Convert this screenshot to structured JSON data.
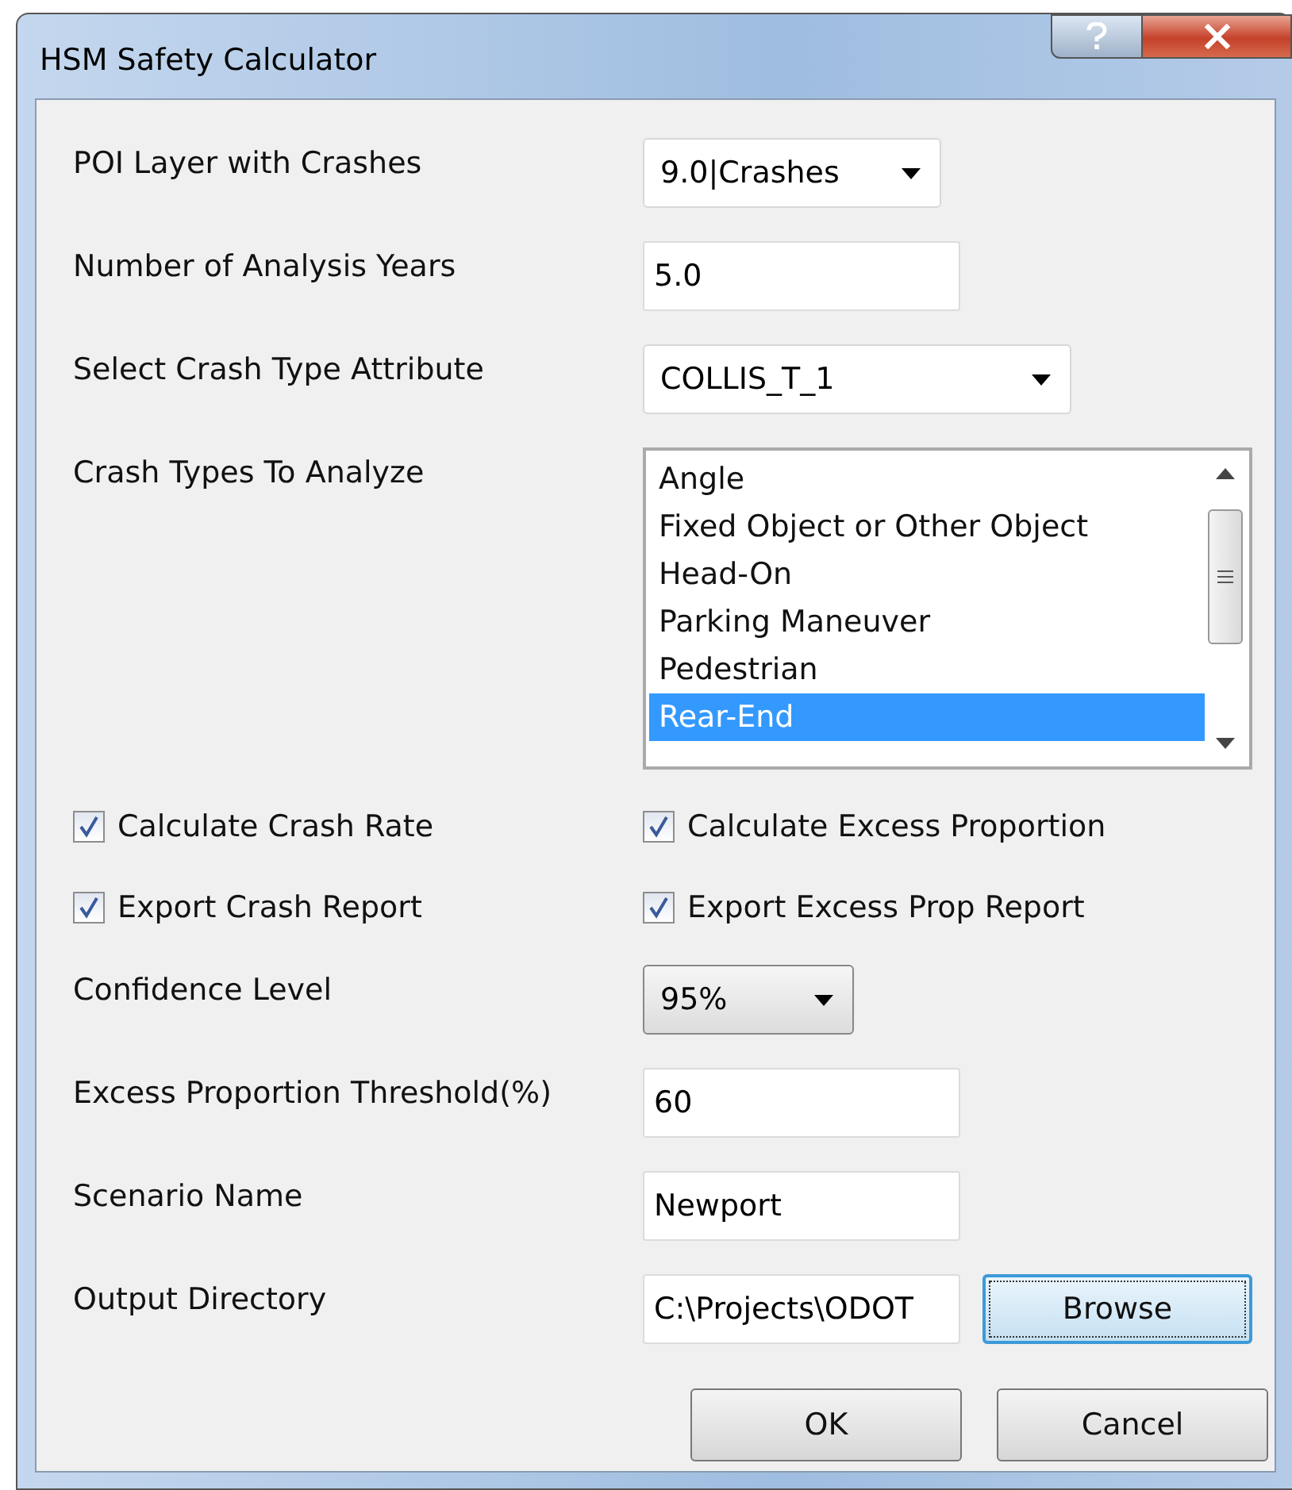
{
  "window": {
    "title": "HSM Safety Calculator"
  },
  "rows": [
    {
      "kind": "dropdown",
      "label": "POI Layer with Crashes",
      "value": "9.0|Crashes"
    },
    {
      "kind": "input",
      "label": "Number of Analysis Years",
      "value": "5.0"
    },
    {
      "kind": "dropdown",
      "label": "Select Crash Type Attribute",
      "value": "COLLIS_T_1"
    },
    {
      "kind": "listbox",
      "label": "Crash Types To Analyze",
      "items": [
        {
          "label": "Angle",
          "selected": false
        },
        {
          "label": "Fixed Object or Other Object",
          "selected": false
        },
        {
          "label": "Head-On",
          "selected": false
        },
        {
          "label": "Parking Maneuver",
          "selected": false
        },
        {
          "label": "Pedestrian",
          "selected": false
        },
        {
          "label": "Rear-End",
          "selected": true
        }
      ]
    },
    {
      "kind": "checks",
      "items": [
        {
          "label": "Calculate Crash Rate",
          "checked": true
        },
        {
          "label": "Calculate Excess Proportion",
          "checked": true
        }
      ]
    },
    {
      "kind": "checks",
      "items": [
        {
          "label": "Export Crash Report",
          "checked": true
        },
        {
          "label": "Export Excess Prop Report",
          "checked": true
        }
      ]
    },
    {
      "kind": "dropdown",
      "label": "Confidence Level",
      "value": "95%"
    },
    {
      "kind": "input",
      "label": "Excess Proportion Threshold(%)",
      "value": "60"
    },
    {
      "kind": "input",
      "label": "Scenario Name",
      "value": "Newport"
    },
    {
      "kind": "browse",
      "label": "Output Directory",
      "value": "C:\\Projects\\ODOT",
      "button": "Browse"
    }
  ],
  "buttons": [
    "OK",
    "Cancel"
  ]
}
